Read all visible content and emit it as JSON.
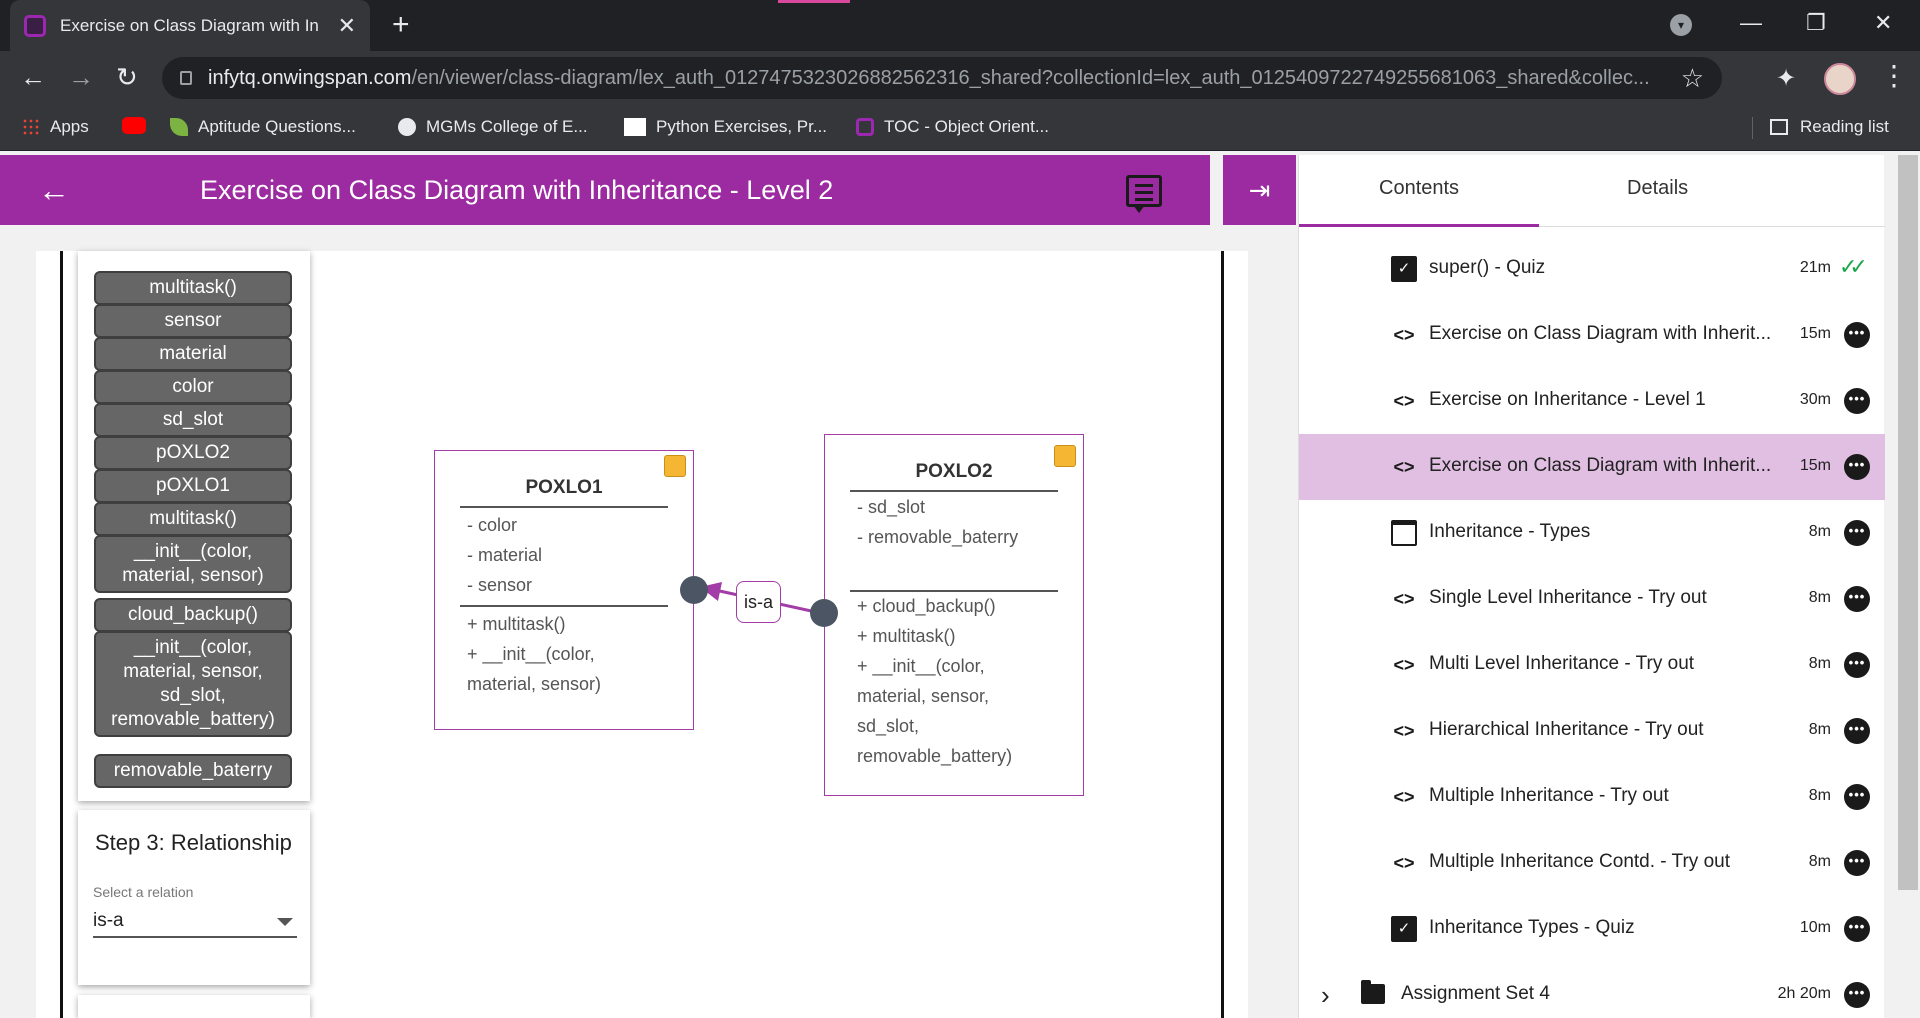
{
  "browser": {
    "tab_title": "Exercise on Class Diagram with In",
    "url_host": "infytq.onwingspan.com",
    "url_path": "/en/viewer/class-diagram/lex_auth_012747532302688256231​6_shared?collectionId=lex_auth_012540972274925568106​3_shared&collec...",
    "bookmarks": [
      {
        "label": "Apps",
        "icon": "apps-grid-icon"
      },
      {
        "label": "",
        "icon": "youtube-icon"
      },
      {
        "label": "Aptitude Questions...",
        "icon": "leaf-icon"
      },
      {
        "label": "MGMs College of E...",
        "icon": "globe-icon"
      },
      {
        "label": "Python Exercises, Pr...",
        "icon": "w3r-icon"
      },
      {
        "label": "TOC - Object Orient...",
        "icon": "infytq-icon"
      }
    ],
    "reading_list": "Reading list"
  },
  "header": {
    "title": "Exercise on Class Diagram with Inheritance - Level 2"
  },
  "palette": {
    "chips": [
      "multitask()",
      "sensor",
      "material",
      "color",
      "sd_slot",
      "pOXLO2",
      "pOXLO1",
      "multitask()",
      "__init__(color, material, sensor)",
      "cloud_backup()",
      "__init__(color, material, sensor, sd_slot, removable_battery)",
      "removable_baterry"
    ]
  },
  "step3": {
    "title": "Step 3: Relationship",
    "select_label": "Select a relation",
    "select_value": "is-a"
  },
  "diagram": {
    "class1": {
      "name": "POXLO1",
      "attributes": [
        "- color",
        "- material",
        "- sensor"
      ],
      "methods": [
        "+ multitask()",
        "+ __init__(color,",
        "material, sensor)"
      ]
    },
    "class2": {
      "name": "POXLO2",
      "attributes": [
        "- sd_slot",
        "- removable_baterry"
      ],
      "methods": [
        "+ cloud_backup()",
        "+ multitask()",
        "+ __init__(color,",
        "material, sensor,",
        "sd_slot,",
        "removable_battery)"
      ]
    },
    "relation_label": "is-a"
  },
  "side_panel": {
    "tabs": [
      "Contents",
      "Details"
    ],
    "items": [
      {
        "title": "super() - Quiz",
        "duration": "21m",
        "icon": "quiz-icon",
        "status": "completed"
      },
      {
        "title": "Exercise on Class Diagram with Inherit...",
        "duration": "15m",
        "icon": "code-icon"
      },
      {
        "title": "Exercise on Inheritance - Level 1",
        "duration": "30m",
        "icon": "code-icon"
      },
      {
        "title": "Exercise on Class Diagram with Inherit...",
        "duration": "15m",
        "icon": "code-icon",
        "active": true
      },
      {
        "title": "Inheritance - Types",
        "duration": "8m",
        "icon": "window-icon"
      },
      {
        "title": "Single Level Inheritance - Try out",
        "duration": "8m",
        "icon": "code-icon"
      },
      {
        "title": "Multi Level Inheritance - Try out",
        "duration": "8m",
        "icon": "code-icon"
      },
      {
        "title": "Hierarchical Inheritance - Try out",
        "duration": "8m",
        "icon": "code-icon"
      },
      {
        "title": "Multiple Inheritance - Try out",
        "duration": "8m",
        "icon": "code-icon"
      },
      {
        "title": "Multiple Inheritance Contd. - Try out",
        "duration": "8m",
        "icon": "code-icon"
      },
      {
        "title": "Inheritance Types - Quiz",
        "duration": "10m",
        "icon": "quiz-icon"
      }
    ],
    "folder": {
      "title": "Assignment Set 4",
      "duration": "2h 20m"
    }
  },
  "colors": {
    "brand_purple": "#9c2aa0",
    "active_row": "#e1bfe2",
    "chip_gray": "#666666",
    "note_flag": "#f5b733",
    "check_green": "#1aa64a"
  }
}
